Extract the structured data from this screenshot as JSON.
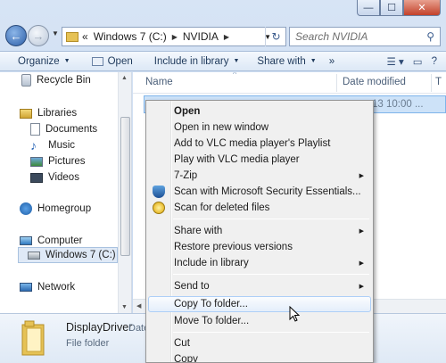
{
  "window": {
    "minimize_glyph": "—",
    "maximize_glyph": "☐",
    "close_glyph": "✕"
  },
  "address": {
    "overflow": "«",
    "crumbs": [
      "Windows 7 (C:)",
      "NVIDIA"
    ],
    "search_placeholder": "Search NVIDIA"
  },
  "toolbar": {
    "organize": "Organize",
    "open": "Open",
    "include_in_library": "Include in library",
    "share_with": "Share with",
    "more": "»"
  },
  "nav_pane": {
    "recycle_bin": "Recycle Bin",
    "libraries": "Libraries",
    "documents": "Documents",
    "music": "Music",
    "pictures": "Pictures",
    "videos": "Videos",
    "homegroup": "Homegroup",
    "computer": "Computer",
    "windows7": "Windows 7 (C:)",
    "network": "Network"
  },
  "content": {
    "col_name": "Name",
    "col_date": "Date modified",
    "col_type": "T",
    "file_date": "13 10:00 ..."
  },
  "details": {
    "name": "DisplayDriver",
    "type": "File folder",
    "date_label": "Date"
  },
  "context_menu": {
    "open": "Open",
    "open_new_window": "Open in new window",
    "add_vlc": "Add to VLC media player's Playlist",
    "play_vlc": "Play with VLC media player",
    "zip": "7-Zip",
    "scan_mse": "Scan with Microsoft Security Essentials...",
    "scan_deleted": "Scan for deleted files",
    "share_with": "Share with",
    "restore": "Restore previous versions",
    "include_library": "Include in library",
    "send_to": "Send to",
    "copy_to_folder": "Copy To folder...",
    "move_to_folder": "Move To folder...",
    "cut": "Cut",
    "copy": "Copy"
  },
  "colors": {
    "accent": "#3d6fb4",
    "selection": "#cde2f8",
    "menu_bg": "#f0f0f0",
    "close_red": "#c2412a"
  }
}
